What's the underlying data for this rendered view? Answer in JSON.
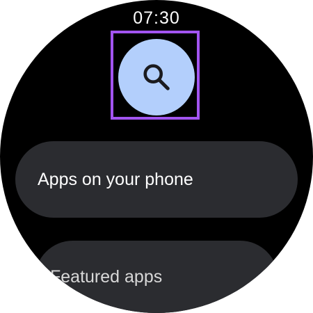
{
  "status": {
    "time": "07:30"
  },
  "search": {
    "icon": "search-icon",
    "color": "#b3cffc",
    "highlight_color": "#a254f0"
  },
  "list": {
    "items": [
      {
        "label": "Apps on your phone"
      },
      {
        "label": "Featured apps"
      }
    ]
  },
  "colors": {
    "background": "#000000",
    "chip": "#2b2c30",
    "text": "#ffffff"
  }
}
